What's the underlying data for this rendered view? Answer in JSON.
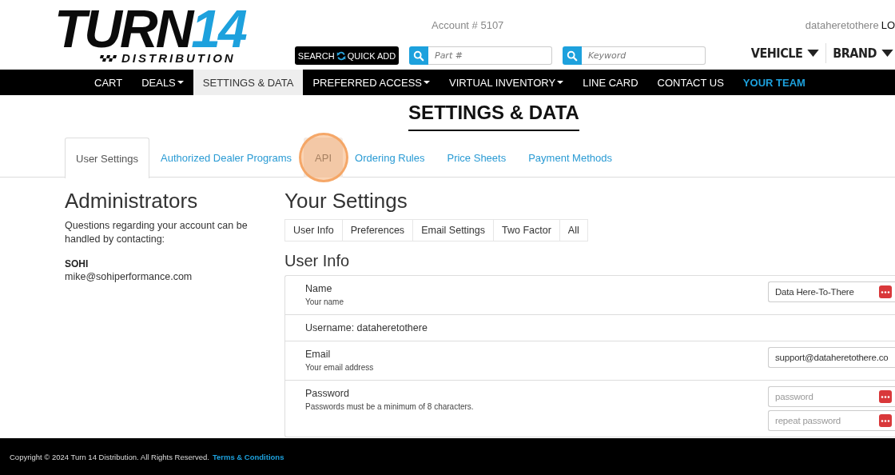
{
  "logo": {
    "word": "TURN",
    "number": "14",
    "tagline": "DISTRIBUTION"
  },
  "account": "Account # 5107",
  "user": {
    "name": "dataheretothere",
    "action": "LO"
  },
  "quick_add": {
    "left": "SEARCH",
    "right": "QUICK ADD"
  },
  "search_fields": [
    {
      "placeholder": "Part #"
    },
    {
      "placeholder": "Keyword"
    }
  ],
  "filters": [
    {
      "label": "VEHICLE"
    },
    {
      "label": "BRAND"
    }
  ],
  "nav": [
    {
      "label": "CART",
      "dropdown": false,
      "selected": false,
      "highlight": false
    },
    {
      "label": "DEALS",
      "dropdown": true,
      "selected": false,
      "highlight": false
    },
    {
      "label": "SETTINGS & DATA",
      "dropdown": false,
      "selected": true,
      "highlight": false
    },
    {
      "label": "PREFERRED ACCESS",
      "dropdown": true,
      "selected": false,
      "highlight": false
    },
    {
      "label": "VIRTUAL INVENTORY",
      "dropdown": true,
      "selected": false,
      "highlight": false
    },
    {
      "label": "LINE CARD",
      "dropdown": false,
      "selected": false,
      "highlight": false
    },
    {
      "label": "CONTACT US",
      "dropdown": false,
      "selected": false,
      "highlight": false
    },
    {
      "label": "YOUR TEAM",
      "dropdown": false,
      "selected": false,
      "highlight": true
    }
  ],
  "page_title": "SETTINGS & DATA",
  "tabs": [
    {
      "label": "User Settings",
      "selected": true,
      "clicked": false
    },
    {
      "label": "Authorized Dealer Programs",
      "selected": false,
      "clicked": false
    },
    {
      "label": "API",
      "selected": false,
      "clicked": true
    },
    {
      "label": "Ordering Rules",
      "selected": false,
      "clicked": false
    },
    {
      "label": "Price Sheets",
      "selected": false,
      "clicked": false
    },
    {
      "label": "Payment Methods",
      "selected": false,
      "clicked": false
    }
  ],
  "administrators": {
    "title": "Administrators",
    "text": "Questions regarding your account can be handled by contacting:",
    "contact_name": "SOHI",
    "contact_email": "mike@sohiperformance.com"
  },
  "settings": {
    "title": "Your Settings",
    "subtabs": [
      {
        "label": "User Info",
        "selected": false
      },
      {
        "label": "Preferences",
        "selected": false
      },
      {
        "label": "Email Settings",
        "selected": false
      },
      {
        "label": "Two Factor",
        "selected": false
      },
      {
        "label": "All",
        "selected": false
      }
    ],
    "section_title": "User Info",
    "rows": [
      {
        "kind": "field",
        "label": "Name",
        "hint": "Your name",
        "fields": [
          {
            "value": "Data Here-To-There",
            "button": true
          }
        ]
      },
      {
        "kind": "text",
        "label": "Username: dataheretothere"
      },
      {
        "kind": "field",
        "label": "Email",
        "hint": "Your email address",
        "fields": [
          {
            "value": "support@dataheretothere.co",
            "button": false
          }
        ]
      },
      {
        "kind": "field",
        "label": "Password",
        "hint": "Passwords must be a minimum of 8 characters.",
        "fields": [
          {
            "placeholder": "password",
            "button": true
          },
          {
            "placeholder": "repeat password",
            "button": true
          }
        ]
      }
    ]
  },
  "footer": {
    "copyright": "Copyright © 2024 Turn 14 Distribution. All Rights Reserved.",
    "link": "Terms & Conditions"
  }
}
